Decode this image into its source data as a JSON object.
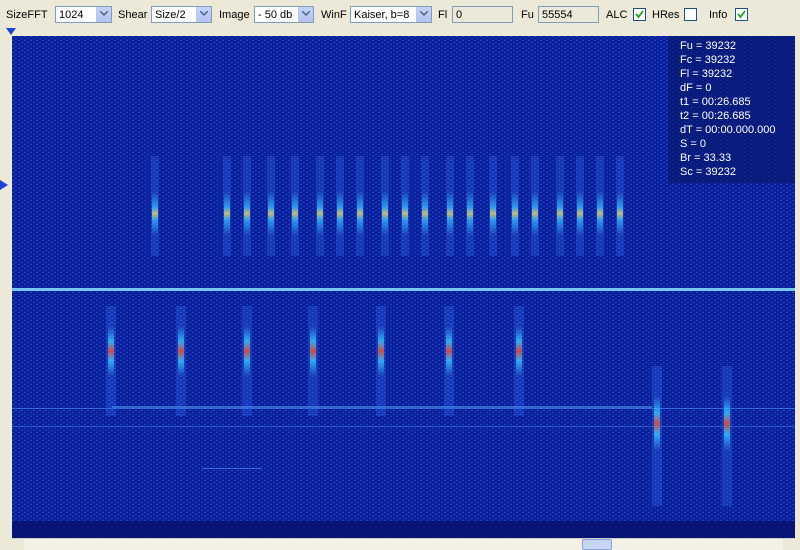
{
  "toolbar": {
    "size_fft_label": "SizeFFT",
    "size_fft_value": "1024",
    "shear_label": "Shear",
    "shear_value": "Size/2",
    "image_label": "Image",
    "image_value": "- 50 db",
    "winf_label": "WinF",
    "winf_value": "Kaiser, b=8",
    "fl_label": "Fl",
    "fl_value": "0",
    "fu_label": "Fu",
    "fu_value": "55554",
    "alc_label": "ALC",
    "alc_checked": true,
    "hres_label": "HRes",
    "hres_checked": false,
    "info_label": "Info",
    "info_checked": true
  },
  "info_overlay": {
    "fu": "Fu = 39232",
    "fc": "Fc = 39232",
    "fl": "Fl = 39232",
    "df": "dF = 0",
    "t1": "t1 = 00:26.685",
    "t2": "t2 = 00:26.685",
    "dt": "dT = 00:00.000.000",
    "s": "S = 0",
    "br": "Br = 33.33",
    "sc": "Sc = 39232"
  },
  "colors": {
    "spectrogram_background": "#0a1f9a",
    "marker": "#1f3fd6",
    "signal_hot": "#ff3a00",
    "signal_mid": "#ffd84a",
    "signal_low": "#36e0ff"
  }
}
